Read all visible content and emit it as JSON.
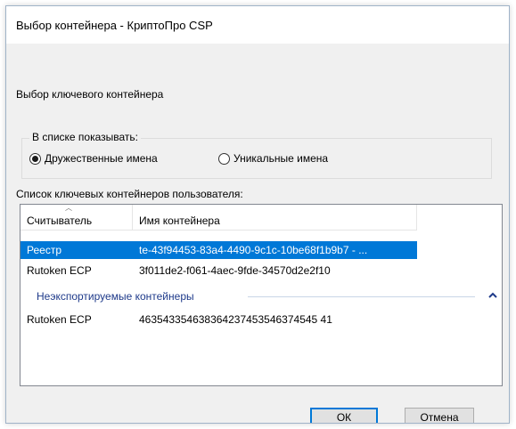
{
  "window": {
    "title": "Выбор контейнера - КриптоПро CSP"
  },
  "dialog": {
    "caption": "Выбор ключевого контейнера",
    "show_group": {
      "legend": "В списке показывать:",
      "options": [
        {
          "label": "Дружественные имена",
          "checked": true
        },
        {
          "label": "Уникальные имена",
          "checked": false
        }
      ]
    },
    "list_caption": "Список ключевых контейнеров пользователя:",
    "columns": [
      "Считыватель",
      "Имя контейнера"
    ],
    "rows": [
      {
        "reader": "Реестр",
        "name": "te-43f94453-83a4-4490-9c1c-10be68f1b9b7 - ...",
        "selected": true
      },
      {
        "reader": "Rutoken ECP",
        "name": "3f011de2-f061-4aec-9fde-34570d2e2f10",
        "selected": false
      }
    ],
    "group": {
      "title": "Неэкспортируемые контейнеры",
      "rows": [
        {
          "reader": "Rutoken ECP",
          "name": "463543354638364237453546374545 41"
        }
      ]
    },
    "buttons": {
      "ok": "ОК",
      "cancel": "Отмена"
    }
  },
  "colors": {
    "selection": "#0078d7",
    "group_title": "#1e3a8a"
  },
  "icons": {
    "sort": "sort-ascending-icon",
    "group_collapse": "chevron-up-icon"
  }
}
